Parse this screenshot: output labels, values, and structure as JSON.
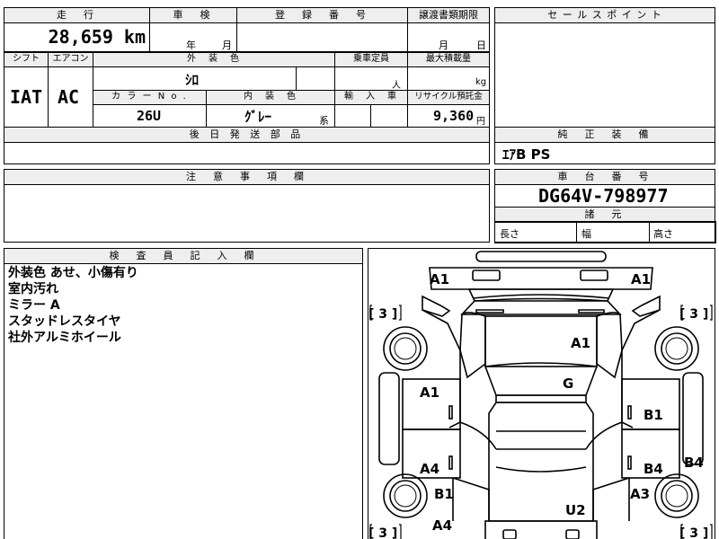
{
  "top_labels": {
    "mileage": "走　行",
    "inspection": "車　検",
    "registration": "登　録　番　号",
    "transfer": "譲渡書類期限",
    "sales_point": "セ ー ル ス ポ イ ン ト"
  },
  "mileage_value": "28,659 km",
  "inspection_fields": {
    "year": "年",
    "month": "月"
  },
  "transfer_fields": {
    "month": "月",
    "day": "日"
  },
  "row2_labels": {
    "shift": "シフト",
    "aircon": "エアコン",
    "exterior_color": "外　装　色",
    "capacity": "乗車定員",
    "max_load": "最大積載量"
  },
  "shift_value": "IAT",
  "aircon_value": "AC",
  "exterior_color_value": "ｼﾛ",
  "capacity_unit": "人",
  "load_unit": "kg",
  "row3_labels": {
    "color_no": "カ ラ ー  N o .",
    "interior_color": "内　装　色",
    "import": "輸　入　車",
    "recycle": "リサイクル預託金"
  },
  "color_no_value": "26U",
  "interior_color_value": "ｸﾞﾚｰ",
  "interior_suffix": "系",
  "recycle_value": "9,360",
  "recycle_unit": "円",
  "later_parts_label": "後 日 発 送 部 品",
  "genuine_equipment_label": "純　正　装　備",
  "genuine_equipment_value": "ｴｱB PS",
  "notice_label": "注　意　事　項　欄",
  "chassis_label": "車　台　番　号",
  "chassis_value": "DG64V-798977",
  "dimensions_label": "諸　元",
  "dimensions": {
    "length": "長さ",
    "width": "幅",
    "height": "高さ"
  },
  "inspector_label": "検　査　員　記　入　欄",
  "inspector_notes": [
    "外装色 あせ、小傷有り",
    "室内汚れ",
    "ミラー A",
    "スタッドレスタイヤ",
    "社外アルミホイール"
  ],
  "diagram": {
    "tire_tl": "[ 3 ]",
    "tire_tr": "[ 3 ]",
    "tire_bl": "[ 3 ]",
    "tire_br": "[ 3 ]",
    "lamp_left": "A1",
    "lamp_right": "A1",
    "roof": "A1",
    "glass": "G",
    "left_front_door": "A1",
    "left_rear_door": "A4",
    "left_rear_fender": "B1",
    "left_bottom": "A4",
    "right_front_door": "B1",
    "right_rear_door": "B4",
    "right_side": "B4",
    "right_rear_fender": "A3",
    "rear_panel": "U2"
  }
}
